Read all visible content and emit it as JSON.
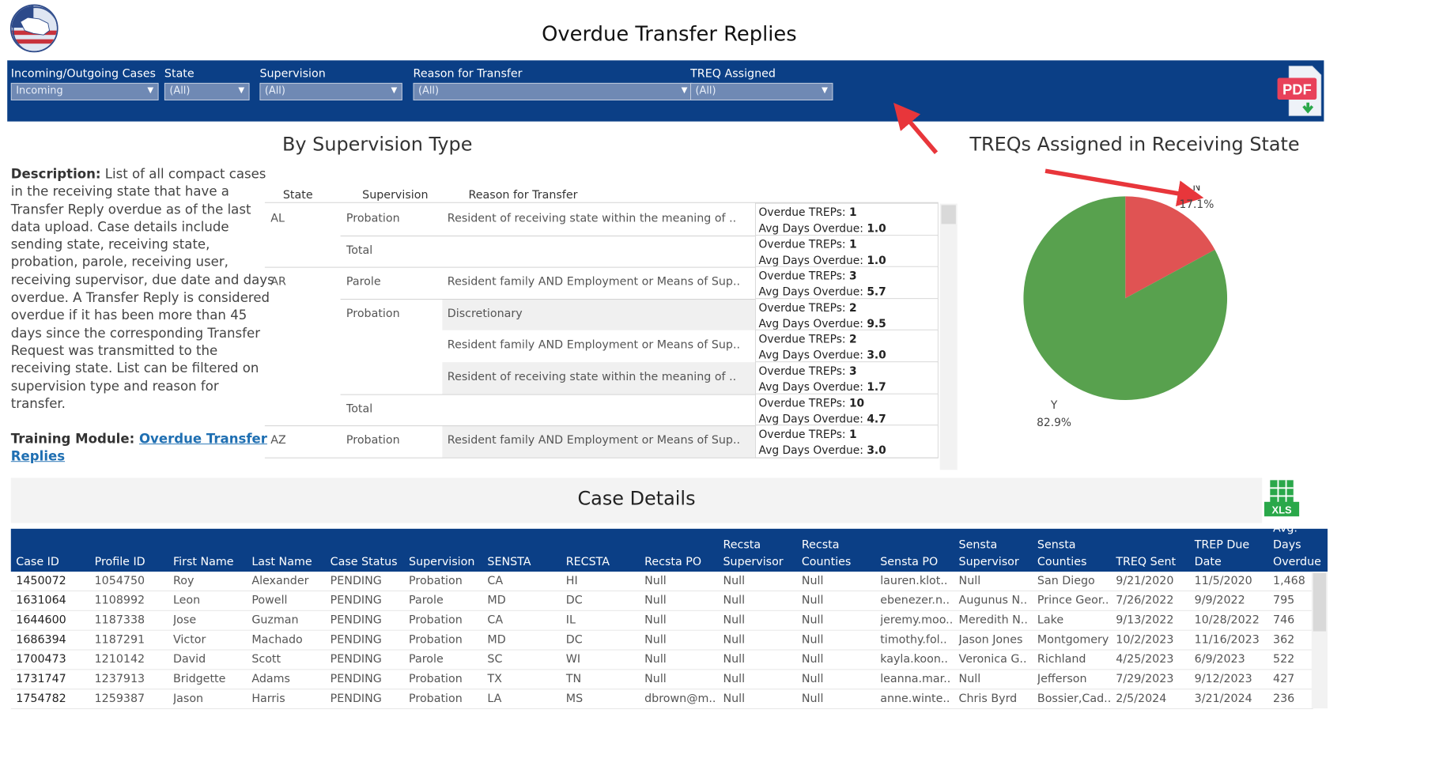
{
  "title": "Overdue Transfer Replies",
  "filters": [
    {
      "label": "Incoming/Outgoing Cases",
      "value": "Incoming"
    },
    {
      "label": "State",
      "value": "(All)"
    },
    {
      "label": "Supervision",
      "value": "(All)"
    },
    {
      "label": "Reason for Transfer",
      "value": "(All)"
    },
    {
      "label": "TREQ Assigned",
      "value": "(All)"
    }
  ],
  "icons": {
    "pdf": "PDF",
    "xls": "XLS"
  },
  "description": {
    "label": "Description:",
    "text": " List of all compact cases in the receiving state that have a Transfer Reply overdue as of the last data upload. Case details include sending state, receiving state, probation, parole, receiving user, receiving supervisor, due date and days overdue. A Transfer Reply is considered overdue if it has been more than 45 days since the corresponding Transfer Request was transmitted to the receiving state. List can be filtered on supervision type and reason for transfer.",
    "training_label": "Training Module: ",
    "training_link": "Overdue Transfer Replies"
  },
  "supervision": {
    "title": "By Supervision Type",
    "headers": [
      "State",
      "Supervision",
      "Reason for Transfer"
    ],
    "overdue_label": "Overdue TREPs: ",
    "avg_label": "Avg Days Overdue: ",
    "rows": [
      {
        "state": "AL",
        "supervision": "Probation",
        "reason": "Resident of receiving state within the meaning of ..",
        "overdue": "1",
        "avg": "1.0"
      },
      {
        "state": "",
        "supervision": "Total",
        "reason": "",
        "overdue": "1",
        "avg": "1.0"
      },
      {
        "state": "AR",
        "supervision": "Parole",
        "reason": "Resident family AND Employment or Means of Sup..",
        "overdue": "3",
        "avg": "5.7"
      },
      {
        "state": "",
        "supervision": "Probation",
        "reason": "Discretionary",
        "overdue": "2",
        "avg": "9.5"
      },
      {
        "state": "",
        "supervision": "",
        "reason": "Resident family AND Employment or Means of Sup..",
        "overdue": "2",
        "avg": "3.0"
      },
      {
        "state": "",
        "supervision": "",
        "reason": "Resident of receiving state within the meaning of ..",
        "overdue": "3",
        "avg": "1.7"
      },
      {
        "state": "",
        "supervision": "Total",
        "reason": "",
        "overdue": "10",
        "avg": "4.7"
      },
      {
        "state": "AZ",
        "supervision": "Probation",
        "reason": "Resident family AND Employment or Means of Sup..",
        "overdue": "1",
        "avg": "3.0"
      }
    ]
  },
  "chart_data": {
    "type": "pie",
    "title": "TREQs Assigned in Receiving State",
    "categories": [
      "N",
      "Y"
    ],
    "values": [
      17.1,
      82.9
    ],
    "labels": [
      "17.1%",
      "82.9%"
    ],
    "colors": [
      "#e05353",
      "#58a14e"
    ]
  },
  "case_details": {
    "title": "Case Details",
    "headers": [
      "Case ID",
      "Profile ID",
      "First Name",
      "Last Name",
      "Case Status",
      "Supervision",
      "SENSTA",
      "RECSTA",
      "Recsta PO",
      "Recsta Supervisor",
      "Recsta Counties",
      "Sensta PO",
      "Sensta Supervisor",
      "Sensta Counties",
      "TREQ Sent",
      "TREP Due Date",
      "Avg. Days Overdue"
    ],
    "rows": [
      [
        "1450072",
        "1054750",
        "Roy",
        "Alexander",
        "PENDING",
        "Probation",
        "CA",
        "HI",
        "Null",
        "Null",
        "Null",
        "lauren.klot..",
        "Null",
        "San Diego",
        "9/21/2020",
        "11/5/2020",
        "1,468"
      ],
      [
        "1631064",
        "1108992",
        "Leon",
        "Powell",
        "PENDING",
        "Parole",
        "MD",
        "DC",
        "Null",
        "Null",
        "Null",
        "ebenezer.n..",
        "Augunus N..",
        "Prince Geor..",
        "7/26/2022",
        "9/9/2022",
        "795"
      ],
      [
        "1644600",
        "1187338",
        "Jose",
        "Guzman",
        "PENDING",
        "Probation",
        "CA",
        "IL",
        "Null",
        "Null",
        "Null",
        "jeremy.moo..",
        "Meredith N..",
        "Lake",
        "9/13/2022",
        "10/28/2022",
        "746"
      ],
      [
        "1686394",
        "1187291",
        "Victor",
        "Machado",
        "PENDING",
        "Probation",
        "MD",
        "DC",
        "Null",
        "Null",
        "Null",
        "timothy.fol..",
        "Jason Jones",
        "Montgomery",
        "10/2/2023",
        "11/16/2023",
        "362"
      ],
      [
        "1700473",
        "1210142",
        "David",
        "Scott",
        "PENDING",
        "Parole",
        "SC",
        "WI",
        "Null",
        "Null",
        "Null",
        "kayla.koon..",
        "Veronica G..",
        "Richland",
        "4/25/2023",
        "6/9/2023",
        "522"
      ],
      [
        "1731747",
        "1237913",
        "Bridgette",
        "Adams",
        "PENDING",
        "Probation",
        "TX",
        "TN",
        "Null",
        "Null",
        "Null",
        "leanna.mar..",
        "Null",
        "Jefferson",
        "7/29/2023",
        "9/12/2023",
        "427"
      ],
      [
        "1754782",
        "1259387",
        "Jason",
        "Harris",
        "PENDING",
        "Probation",
        "LA",
        "MS",
        "dbrown@m..",
        "Null",
        "Null",
        "anne.winte..",
        "Chris Byrd",
        "Bossier,Cad..",
        "2/5/2024",
        "3/21/2024",
        "236"
      ]
    ]
  }
}
